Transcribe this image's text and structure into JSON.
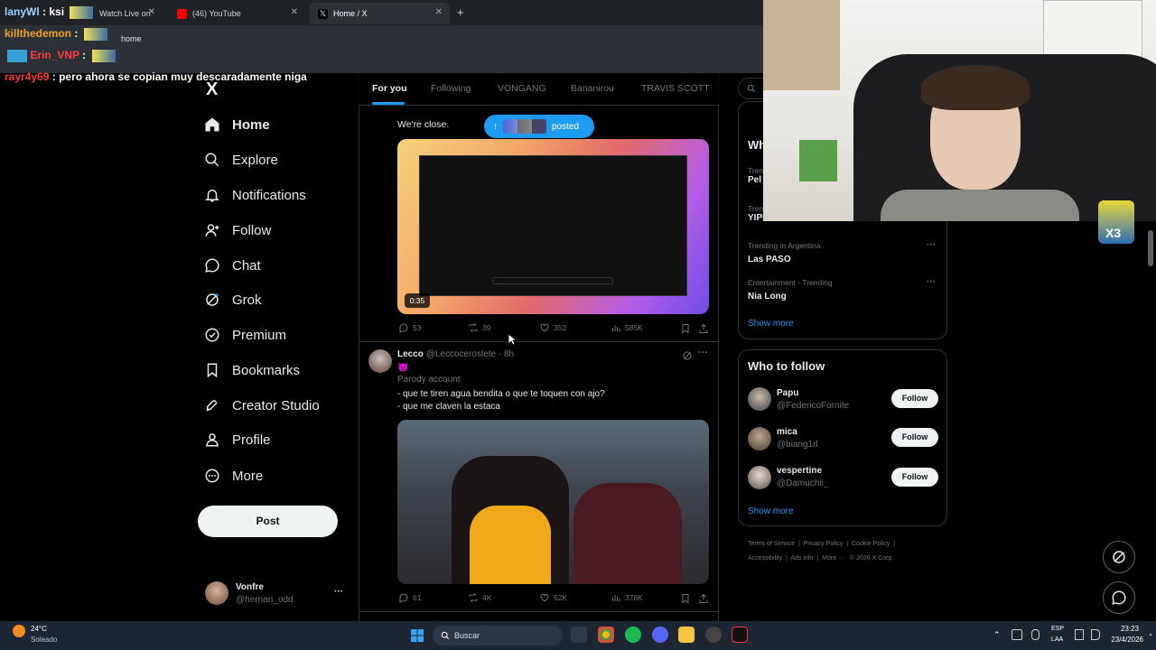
{
  "browser": {
    "tabs": [
      {
        "label": "Watch Live on",
        "active": false
      },
      {
        "label": "(46) YouTube",
        "active": false
      },
      {
        "label": "Home / X",
        "active": true
      }
    ],
    "address": "home"
  },
  "stream_chat": [
    {
      "user": "lanyWl",
      "text": ": ksi",
      "color": "#9bd0ff"
    },
    {
      "user": "killthedemon",
      "text": ":",
      "color": "#f0a020"
    },
    {
      "user": "Erin_VNP",
      "text": ":",
      "color": "#ff3b3b"
    },
    {
      "user": "rayr4y69",
      "text": ": pero ahora se copian muy descaradamente niga",
      "color": "#ff3b3b"
    }
  ],
  "nav": {
    "logo": "X",
    "items": [
      {
        "label": "Home",
        "icon": "home-icon"
      },
      {
        "label": "Explore",
        "icon": "search-icon"
      },
      {
        "label": "Notifications",
        "icon": "bell-icon"
      },
      {
        "label": "Follow",
        "icon": "person-add-icon"
      },
      {
        "label": "Chat",
        "icon": "chat-icon"
      },
      {
        "label": "Grok",
        "icon": "grok-icon"
      },
      {
        "label": "Premium",
        "icon": "premium-icon"
      },
      {
        "label": "Bookmarks",
        "icon": "bookmark-icon"
      },
      {
        "label": "Creator Studio",
        "icon": "rocket-icon"
      },
      {
        "label": "Profile",
        "icon": "person-icon"
      },
      {
        "label": "More",
        "icon": "more-circle-icon"
      }
    ],
    "post_label": "Post",
    "account": {
      "name": "Vonfre",
      "handle": "@hernan_odd",
      "more": "···"
    }
  },
  "feed_tabs": [
    "For you",
    "Following",
    "VONGANG",
    "Bananirou",
    "TRAVIS SCOTT"
  ],
  "posted_pill": {
    "arrow": "↑",
    "label": "posted"
  },
  "tweet1": {
    "text": "We're close.",
    "video_time": "0:35",
    "replies": "53",
    "reposts": "39",
    "likes": "352",
    "views": "585K"
  },
  "tweet2": {
    "name": "Lecco",
    "handle": "@Leccoceroslete",
    "time": "· 8h",
    "emoji": "😈",
    "parody": "Parody account",
    "line1": "- que te tiren agua bendita o que te toquen con ajo?",
    "line2": "- que me claven la estaca",
    "replies": "61",
    "reposts": "4K",
    "likes": "62K",
    "views": "378K"
  },
  "trends": {
    "partial_header": "Wh",
    "items": [
      {
        "context": "Tren",
        "name": "Pel"
      },
      {
        "context": "Tren",
        "name": "YIPIS AL 3000"
      },
      {
        "context": "Trending in Argentina",
        "name": "Las PASO"
      },
      {
        "context": "Entertainment · Trending",
        "name": "Nia Long"
      }
    ],
    "show_more": "Show more"
  },
  "who_to_follow": {
    "title": "Who to follow",
    "users": [
      {
        "name": "Papu",
        "handle": "@FedericoFornite"
      },
      {
        "name": "mica",
        "handle": "@biang1rl"
      },
      {
        "name": "vespertine",
        "handle": "@Damuchii_"
      }
    ],
    "follow_label": "Follow",
    "show_more": "Show more"
  },
  "footer_links": {
    "row1": [
      "Terms of Service",
      "Privacy Policy",
      "Cookie Policy"
    ],
    "row2": [
      "Accessibility",
      "Ads info",
      "More ···",
      "© 2026 X Corp."
    ]
  },
  "taskbar": {
    "weather_temp": "24°C",
    "weather_desc": "Soleado",
    "search_placeholder": "Buscar",
    "lang1": "ESP",
    "lang2": "LAA",
    "time": "23:23",
    "date": "23/4/2026"
  },
  "webcam": {
    "overlay_badge": "X3"
  },
  "colors": {
    "accent": "#1d9bf0",
    "background": "#000000",
    "border": "#2f3336",
    "muted": "#71767b"
  }
}
